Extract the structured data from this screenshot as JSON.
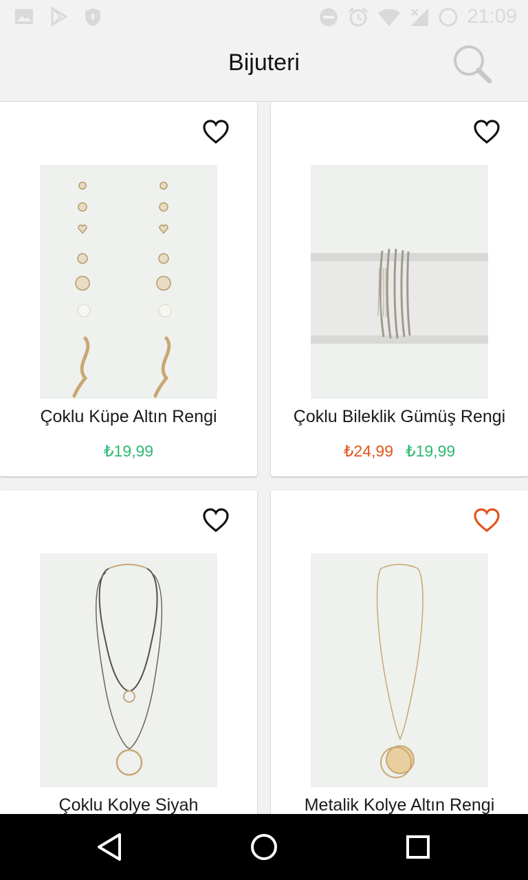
{
  "status_bar": {
    "time": "21:09",
    "left_icons": [
      "image-icon",
      "play-store-icon",
      "shield-icon"
    ],
    "right_icons": [
      "do-not-disturb-icon",
      "alarm-icon",
      "wifi-icon",
      "no-signal-icon",
      "battery-icon"
    ]
  },
  "header": {
    "title": "Bijuteri",
    "search_icon": "search-icon"
  },
  "products": [
    {
      "name": "Çoklu Küpe Altın Rengi",
      "price_old": "",
      "price": "₺19,99",
      "favorite": false
    },
    {
      "name": "Çoklu Bileklik Gümüş Rengi",
      "price_old": "₺24,99",
      "price": "₺19,99",
      "favorite": false
    },
    {
      "name": "Çoklu Kolye Siyah",
      "price_old": "",
      "price": "",
      "favorite": false
    },
    {
      "name": "Metalik Kolye Altın Rengi",
      "price_old": "",
      "price": "",
      "favorite": true
    }
  ],
  "colors": {
    "price_current": "#2fb872",
    "price_old": "#e2551b",
    "favorite_active": "#e2551b",
    "favorite_inactive": "#111111"
  },
  "nav_bar": {
    "back_icon": "back-triangle-icon",
    "home_icon": "home-circle-icon",
    "recents_icon": "recents-square-icon"
  }
}
